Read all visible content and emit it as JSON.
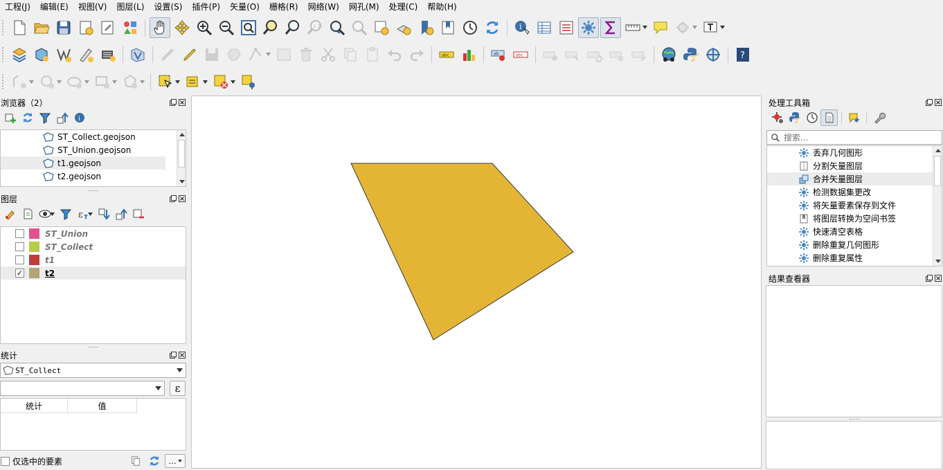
{
  "menu": [
    "工程(J)",
    "编辑(E)",
    "视图(V)",
    "图层(L)",
    "设置(S)",
    "插件(P)",
    "矢量(O)",
    "栅格(R)",
    "网络(W)",
    "网孔(M)",
    "处理(C)",
    "帮助(H)"
  ],
  "browser_panel": {
    "title": "浏览器（2）",
    "items": [
      {
        "label": "ST_Collect.geojson"
      },
      {
        "label": "ST_Union.geojson"
      },
      {
        "label": "t1.geojson"
      },
      {
        "label": "t2.geojson"
      }
    ]
  },
  "layers_panel": {
    "title": "图层",
    "layers": [
      {
        "name": "ST_Union",
        "color": "#e0538f",
        "checked": false
      },
      {
        "name": "ST_Collect",
        "color": "#b8cc46",
        "checked": false
      },
      {
        "name": "t1",
        "color": "#c23b3b",
        "checked": false
      },
      {
        "name": "t2",
        "color": "#b0a676",
        "checked": true
      }
    ]
  },
  "stats_panel": {
    "title": "统计",
    "layer_combo": "ST_Collect",
    "field_combo": "",
    "expression_button": "ε",
    "columns": [
      "统计",
      "值"
    ],
    "selected_only_label": "仅选中的要素",
    "more_button": "…"
  },
  "processing_toolbox": {
    "title": "处理工具箱",
    "search_placeholder": "搜索...",
    "tools": [
      {
        "label": "丢弃几何图形",
        "icon": "gear-icon"
      },
      {
        "label": "分割矢量图层",
        "icon": "split-layer-icon"
      },
      {
        "label": "合并矢量图层",
        "icon": "merge-layers-icon"
      },
      {
        "label": "检测数据集更改",
        "icon": "gear-icon"
      },
      {
        "label": "将矢量要素保存到文件",
        "icon": "gear-icon"
      },
      {
        "label": "将图层转换为空间书签",
        "icon": "bookmark-icon"
      },
      {
        "label": "快速清空表格",
        "icon": "gear-icon"
      },
      {
        "label": "删除重复几何图形",
        "icon": "gear-icon"
      },
      {
        "label": "删除重复属性",
        "icon": "gear-icon"
      }
    ]
  },
  "results_viewer": {
    "title": "结果查看器"
  },
  "map_canvas": {
    "polygon_fill": "#e4b535",
    "polygon_stroke": "#3a3a3a"
  }
}
